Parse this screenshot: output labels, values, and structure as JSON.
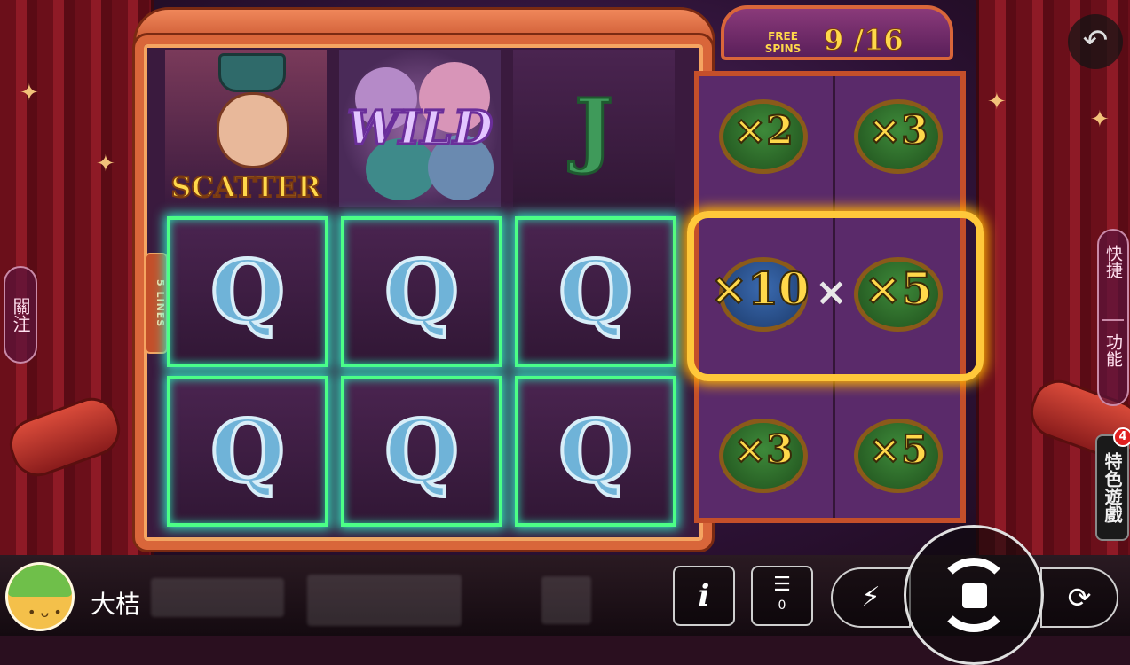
{
  "free_spins": {
    "label_line1": "FREE",
    "label_line2": "SPINS",
    "count": "9 /16"
  },
  "reels": {
    "lines_label": "5 LINES",
    "top_row": [
      {
        "symbol": "SCATTER"
      },
      {
        "symbol": "WILD"
      },
      {
        "symbol": "J"
      }
    ],
    "middle_row": [
      "Q",
      "Q",
      "Q"
    ],
    "bottom_row": [
      "Q",
      "Q",
      "Q"
    ]
  },
  "multipliers": {
    "top": [
      "×2",
      "×3"
    ],
    "middle": [
      "×10",
      "×5"
    ],
    "middle_join": "×",
    "bottom": [
      "×3",
      "×5"
    ]
  },
  "side": {
    "follow": "關注",
    "quick": "快捷",
    "function": "功能",
    "feature_game": "特色遊戲",
    "feature_badge": "4"
  },
  "player": {
    "name": "大桔"
  },
  "controls": {
    "info": "i",
    "history_count": "0",
    "turbo_icon": "lightning-icon",
    "auto_icon": "auto-play-icon"
  },
  "colors": {
    "win_highlight": "#4cff86",
    "multiplier_text": "#ffd84a",
    "frame_orange": "#d9663a"
  }
}
